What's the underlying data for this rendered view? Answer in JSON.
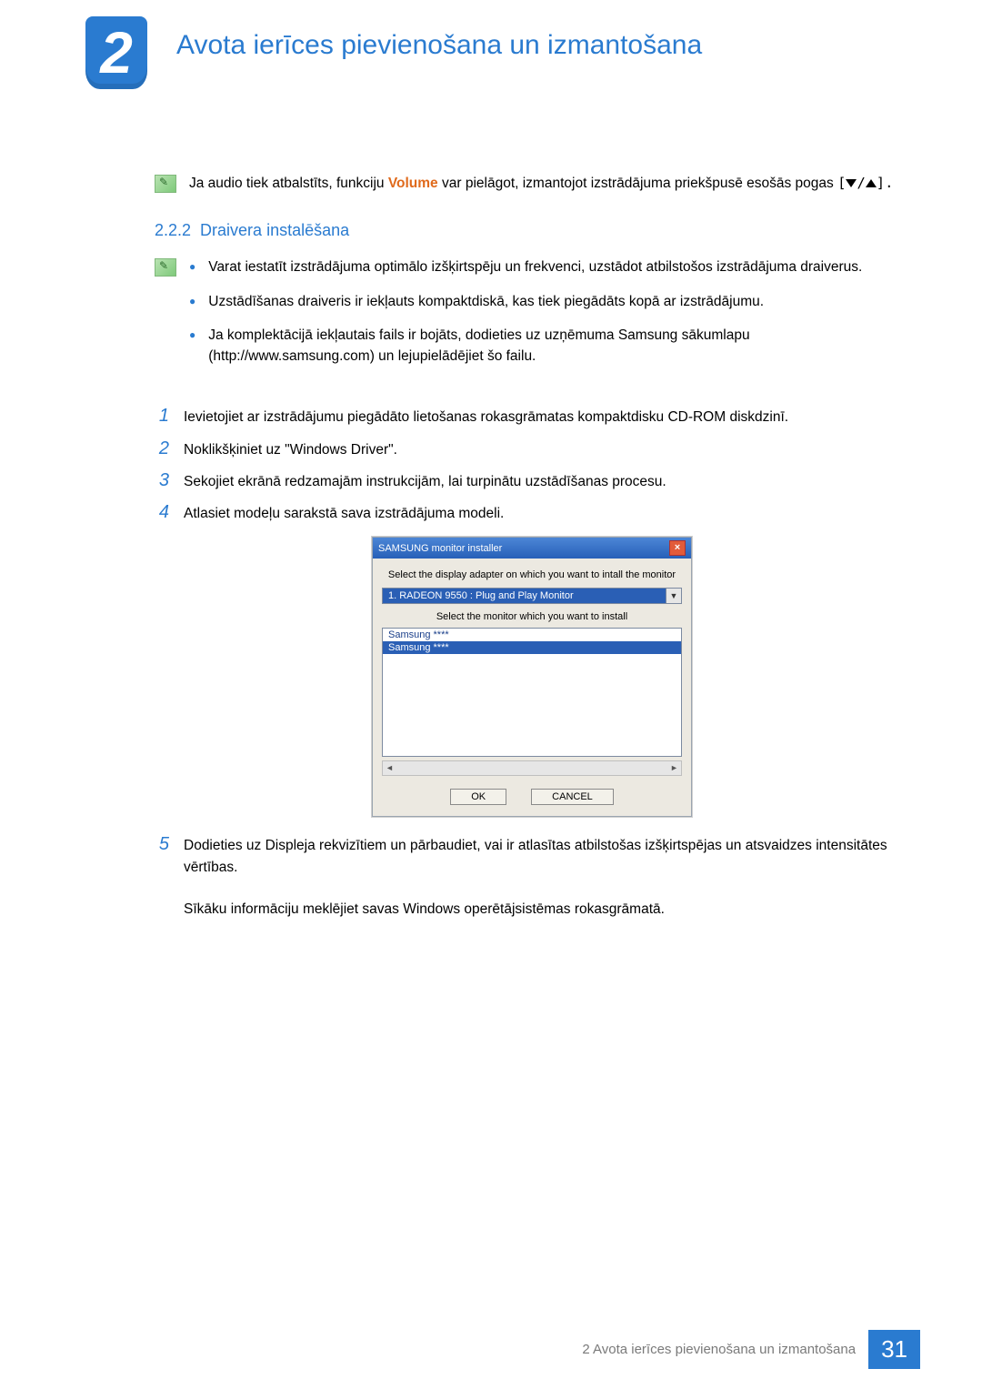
{
  "chapter": {
    "number": "2",
    "title": "Avota ierīces pievienošana un izmantošana"
  },
  "note": {
    "pre": "Ja audio tiek atbalstīts, funkciju ",
    "word": "Volume",
    "post": " var pielāgot, izmantojot izstrādājuma priekšpusē esošās pogas"
  },
  "section": {
    "number": "2.2.2",
    "title": "Draivera instalēšana"
  },
  "bullets": [
    "Varat iestatīt izstrādājuma optimālo izšķirtspēju un frekvenci, uzstādot atbilstošos izstrādājuma draiverus.",
    "Uzstādīšanas draiveris ir iekļauts kompaktdiskā, kas tiek piegādāts kopā ar izstrādājumu.",
    "Ja komplektācijā iekļautais fails ir bojāts, dodieties uz uzņēmuma Samsung sākumlapu (http://www.samsung.com) un lejupielādējiet šo failu."
  ],
  "steps": [
    "Ievietojiet ar izstrādājumu piegādāto lietošanas rokasgrāmatas kompaktdisku CD-ROM diskdzinī.",
    "Noklikšķiniet uz \"Windows Driver\".",
    "Sekojiet ekrānā redzamajām instrukcijām, lai turpinātu uzstādīšanas procesu.",
    "Atlasiet modeļu sarakstā sava izstrādājuma modeli."
  ],
  "step5": {
    "n": "5",
    "line1": "Dodieties uz Displeja rekvizītiem un pārbaudiet, vai ir atlasītas atbilstošas izšķirtspējas un atsvaidzes intensitātes vērtības.",
    "line2": "Sīkāku informāciju meklējiet savas Windows operētājsistēmas rokasgrāmatā."
  },
  "installer": {
    "title": "SAMSUNG monitor installer",
    "label1": "Select the display adapter on which you want to intall the monitor",
    "adapter": "1. RADEON 9550 : Plug and Play Monitor",
    "label2": "Select the monitor which you want to install",
    "list": [
      "Samsung ****",
      "Samsung ****"
    ],
    "ok": "OK",
    "cancel": "CANCEL"
  },
  "footer": {
    "text": "2 Avota ierīces pievienošana un izmantošana",
    "page": "31"
  }
}
